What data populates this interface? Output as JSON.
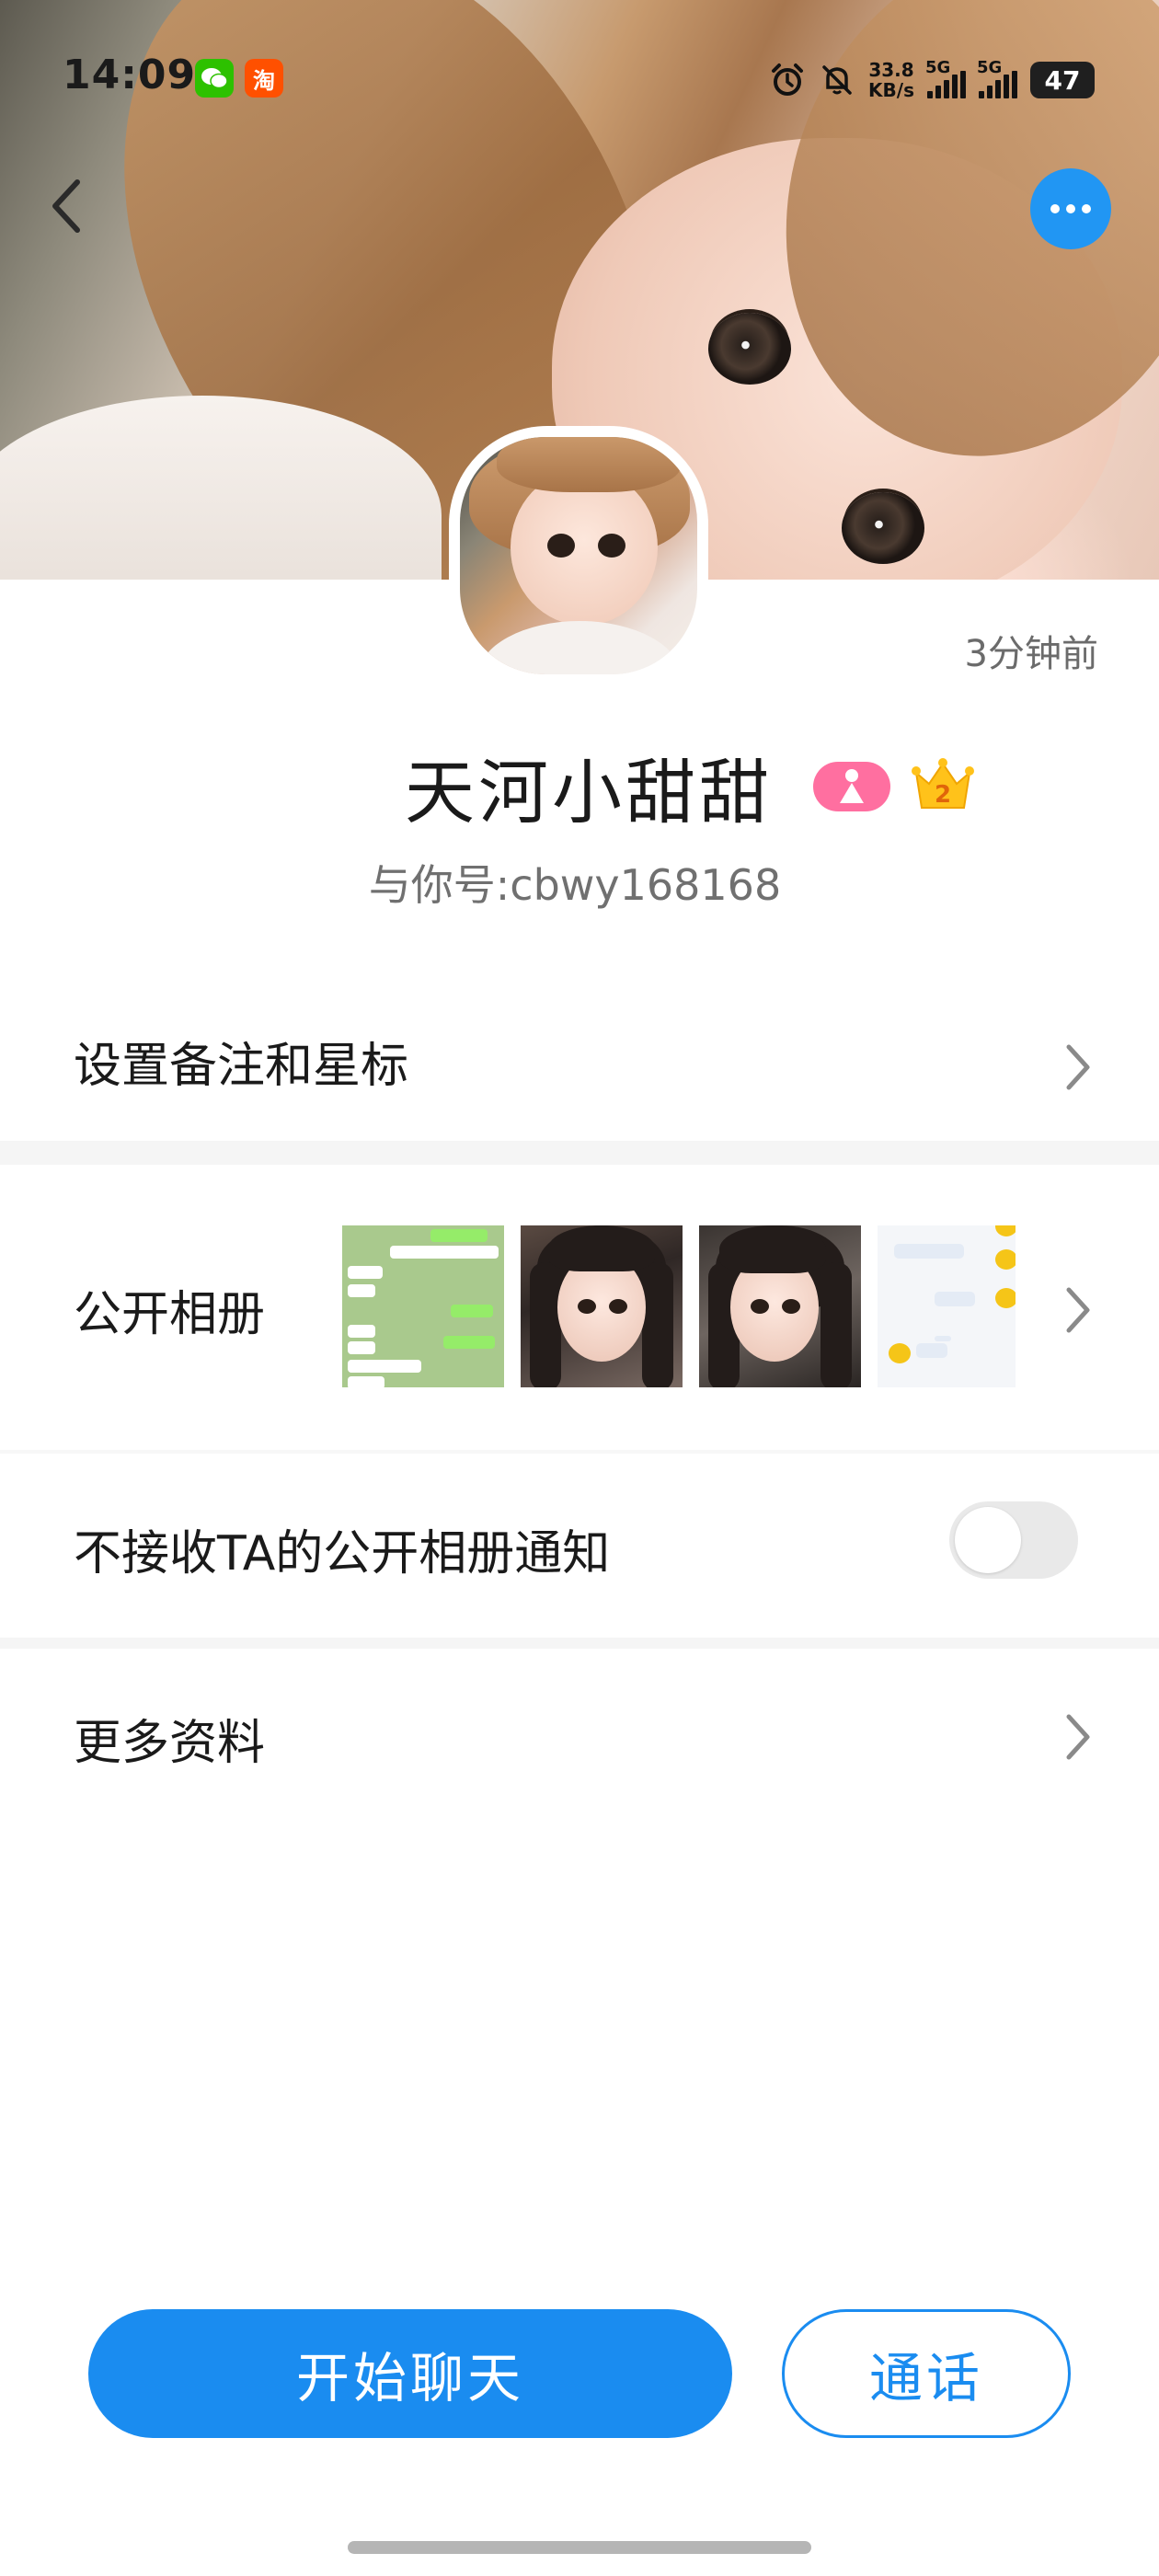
{
  "status_bar": {
    "time": "14:09",
    "notification_apps": [
      "wechat-icon",
      "taobao-icon"
    ],
    "taobao_glyph": "淘",
    "network_speed_value": "33.8",
    "network_speed_unit": "KB/s",
    "signal1_label": "5G",
    "signal2_label": "5G",
    "battery": "47"
  },
  "nav": {
    "back_icon": "chevron-left-icon",
    "more_icon": "more-horizontal-icon",
    "accent_color": "#2196f3"
  },
  "profile": {
    "last_seen": "3分钟前",
    "nickname": "天河小甜甜",
    "account_id": "与你号:cbwy168168",
    "gender_badge_color": "#ff6fa0",
    "level_badge": "2"
  },
  "menu": {
    "remark_label": "设置备注和星标",
    "album_label": "公开相册",
    "notify_label": "不接收TA的公开相册通知",
    "notify_enabled": false,
    "more_info_label": "更多资料"
  },
  "actions": {
    "chat_label": "开始聊天",
    "call_label": "通话",
    "primary_color": "#1a8cf0"
  }
}
